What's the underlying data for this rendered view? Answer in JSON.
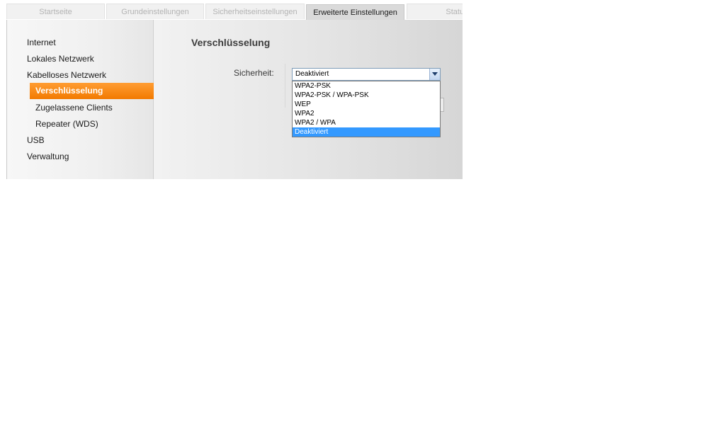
{
  "tabs": [
    {
      "label": "Startseite"
    },
    {
      "label": "Grundeinstellungen"
    },
    {
      "label": "Sicherheitseinstellungen"
    },
    {
      "label": "Erweiterte Einstellungen"
    },
    {
      "label": "Status"
    }
  ],
  "sidebar": {
    "items": [
      {
        "label": "Internet"
      },
      {
        "label": "Lokales Netzwerk"
      },
      {
        "label": "Kabelloses Netzwerk"
      },
      {
        "label": "Verschlüsselung"
      },
      {
        "label": "Zugelassene Clients"
      },
      {
        "label": "Repeater (WDS)"
      },
      {
        "label": "USB"
      },
      {
        "label": "Verwaltung"
      }
    ]
  },
  "main": {
    "title": "Verschlüsselung",
    "security_label": "Sicherheit:",
    "security_value": "Deaktiviert",
    "security_options": [
      {
        "label": "WPA2-PSK"
      },
      {
        "label": "WPA2-PSK / WPA-PSK"
      },
      {
        "label": "WEP"
      },
      {
        "label": "WPA2"
      },
      {
        "label": "WPA2 / WPA"
      },
      {
        "label": "Deaktiviert"
      }
    ]
  },
  "colors": {
    "accent_orange": "#f27a00",
    "selection_blue": "#3399ff"
  }
}
